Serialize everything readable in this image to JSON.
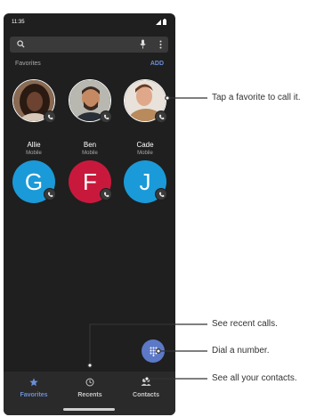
{
  "status": {
    "time": "11:35"
  },
  "search": {
    "placeholder": ""
  },
  "favorites": {
    "section_label": "Favorites",
    "add_label": "ADD",
    "contacts": [
      {
        "name": "Allie",
        "type": "Mobile"
      },
      {
        "name": "Ben",
        "type": "Mobile"
      },
      {
        "name": "Cade",
        "type": "Mobile"
      }
    ],
    "letters": [
      {
        "letter": "G",
        "color": "#1a9ad8"
      },
      {
        "letter": "F",
        "color": "#c8193c"
      },
      {
        "letter": "J",
        "color": "#1a9ad8"
      }
    ]
  },
  "nav": {
    "items": [
      {
        "label": "Favorites",
        "icon": "star-icon",
        "active": true
      },
      {
        "label": "Recents",
        "icon": "clock-icon",
        "active": false
      },
      {
        "label": "Contacts",
        "icon": "people-icon",
        "active": false
      }
    ]
  },
  "callouts": {
    "favorite": "Tap a favorite to call it.",
    "recents": "See recent calls.",
    "dial": "Dial a number.",
    "contacts": "See all your contacts."
  }
}
